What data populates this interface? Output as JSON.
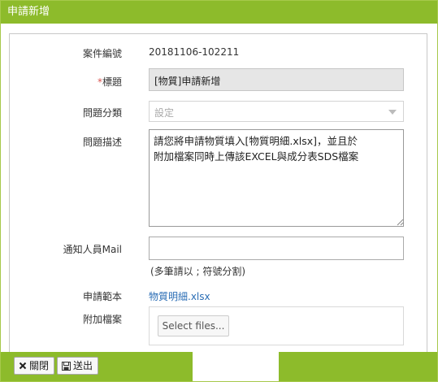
{
  "dialog": {
    "title": "申請新增"
  },
  "form": {
    "case_number": {
      "label": "案件編號",
      "value": "20181106-102211"
    },
    "title": {
      "required_mark": "*",
      "label": "標題",
      "value": "[物質]申請新增"
    },
    "category": {
      "label": "問題分類",
      "value": "設定"
    },
    "description": {
      "label": "問題描述",
      "value": "請您將申請物質填入[物質明細.xlsx]，並且於\n附加檔案同時上傳該EXCEL與成分表SDS檔案"
    },
    "notify": {
      "label": "通知人員Mail",
      "value": "",
      "hint": "(多筆請以 ; 符號分割)"
    },
    "template": {
      "label": "申請範本",
      "link_text": "物質明細.xlsx"
    },
    "attachment": {
      "label": "附加檔案",
      "button_label": "Select files..."
    }
  },
  "footer": {
    "close_label": "關閉",
    "submit_label": "送出"
  },
  "icons": {
    "close": "close-icon",
    "submit": "save-icon",
    "dropdown": "chevron-down-icon"
  },
  "colors": {
    "accent": "#8dbb2b",
    "link": "#2a6db5",
    "required": "#d9534f"
  }
}
